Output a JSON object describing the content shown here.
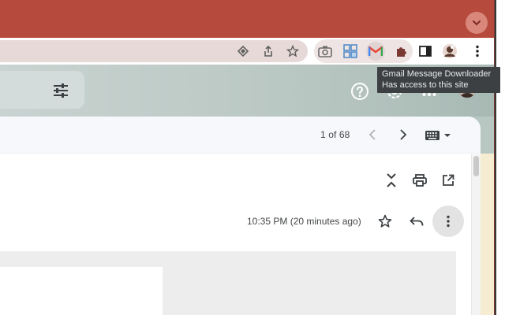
{
  "browser": {
    "tab_menu_icon": "chevron-down-icon",
    "omnibox_icons": [
      "app-install-icon",
      "share-icon",
      "bookmark-star-icon"
    ],
    "extensions": [
      "camera-icon",
      "grid-capture-icon",
      "gmail-icon",
      "puzzle-piece-icon"
    ],
    "right_icons": [
      "sidebar-icon",
      "profile-avatar-icon",
      "more-vert-icon"
    ],
    "tooltip": {
      "title": "Gmail Message Downloader",
      "subtitle": "Has access to this site"
    },
    "colors": {
      "titlebar": "#b64a3c",
      "gmail_red": "#ea4335"
    }
  },
  "gmail": {
    "header_icons": [
      "filter-sliders-icon",
      "help-icon",
      "settings-gear-icon",
      "apps-grid-icon",
      "account-avatar"
    ],
    "pagination": {
      "count": "1 of 68"
    },
    "toolbar_icons": [
      "chevron-left-icon",
      "chevron-right-icon",
      "keyboard-icon"
    ],
    "message_actions": [
      "collapse-all-icon",
      "print-icon",
      "open-in-new-window-icon"
    ],
    "message": {
      "timestamp": "10:35 PM (20 minutes ago)"
    },
    "message_icons": [
      "star-icon",
      "reply-icon",
      "more-vert-icon"
    ]
  }
}
